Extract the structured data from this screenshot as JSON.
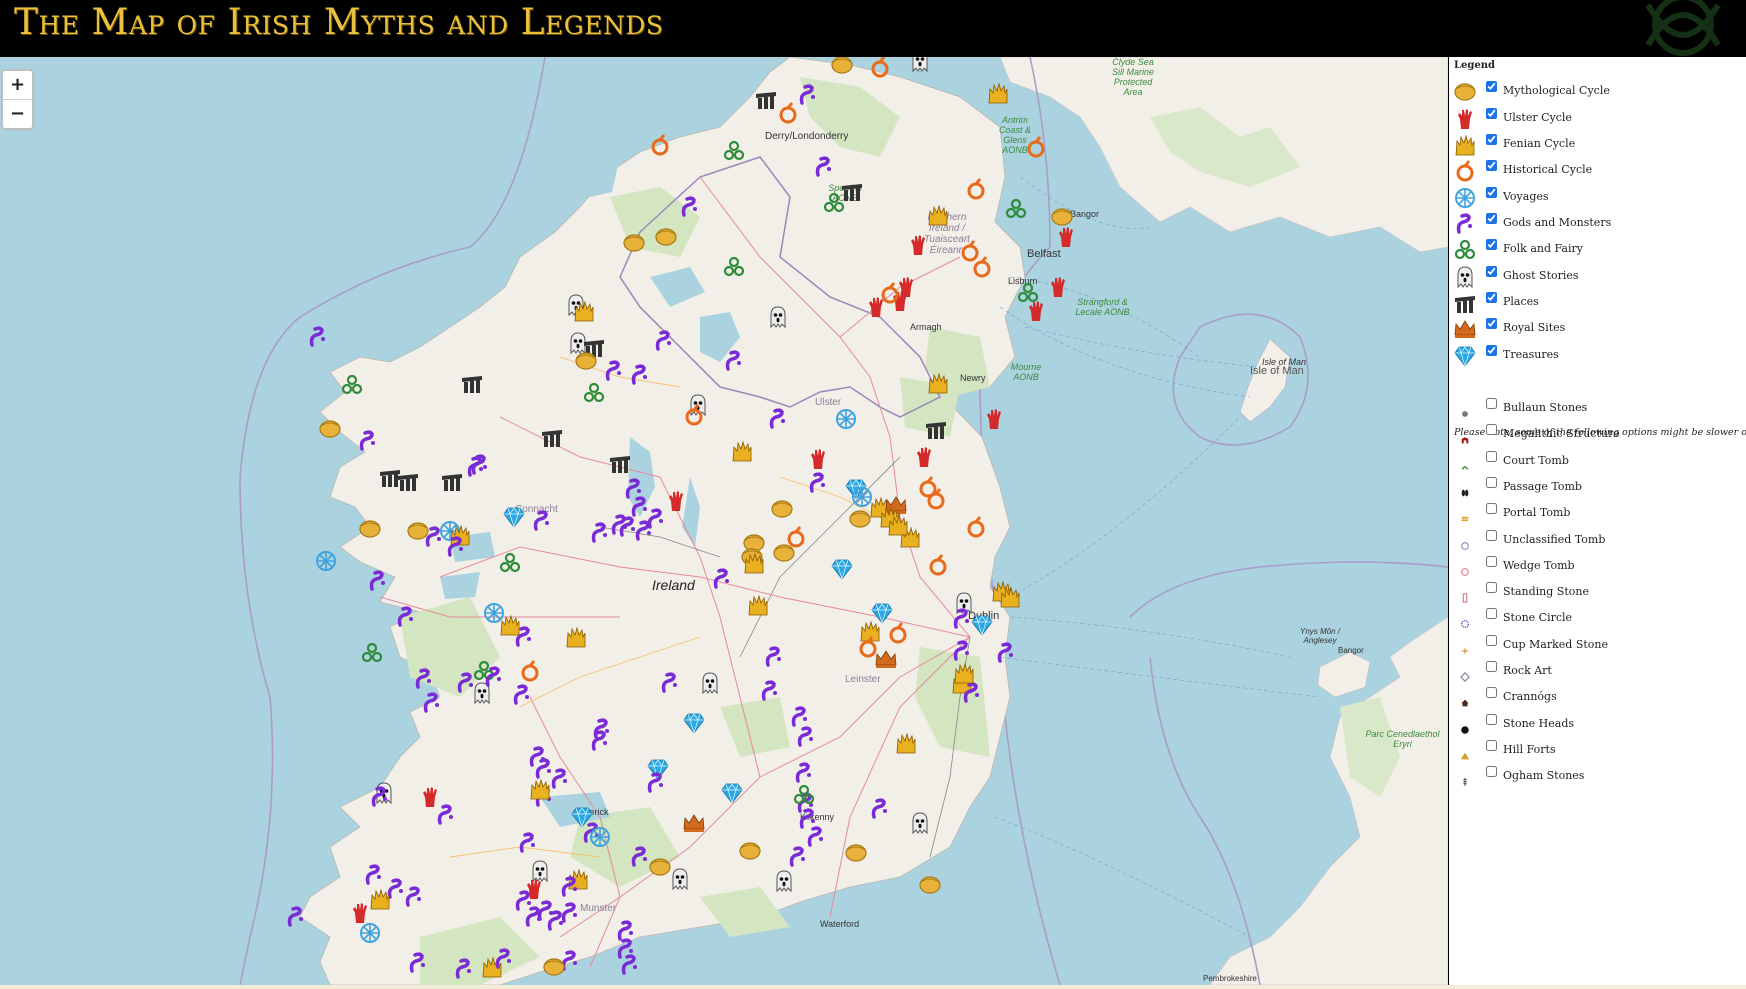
{
  "header": {
    "title": "The Map of Irish Myths and Legends"
  },
  "map": {
    "zoom_in_label": "+",
    "zoom_out_label": "−",
    "labels": {
      "derry": "Derry/Londonderry",
      "belfast": "Belfast",
      "lisburn": "Lisburn",
      "bangor_ni": "Bangor",
      "newry": "Newry",
      "armagh": "Armagh",
      "ireland": "Ireland",
      "ulster": "Ulster",
      "connacht": "Connacht",
      "leinster": "Leinster",
      "munster": "Munster",
      "dublin": "Dublin",
      "kilkenny": "Kilkenny",
      "limerick": "Limerick",
      "waterford": "Waterford",
      "ni": "Northern Ireland / Tuaisceart Éireann",
      "sperrins": "Sperrins AONB",
      "antrim": "Antrim Coast & Glens AONB",
      "mourne": "Mourne AONB",
      "strangford": "Strangford & Lecale AONB",
      "clyde": "Clyde Sea Sill Marine Protected Area",
      "iom1": "Isle of Man",
      "iom2": "Isle of Man",
      "ynys": "Ynys Môn / Anglesey",
      "bangor_wales": "Bangor",
      "eryri": "Parc Cenedlaethol Eryri",
      "pembroke": "Pembrokeshire"
    }
  },
  "legend": {
    "title": "Legend",
    "note": "Please note, some of the following options might be slower on phones:",
    "layers": [
      {
        "label": "Mythological Cycle",
        "checked": true,
        "icon": "sun-disc",
        "color": "#e8b23a"
      },
      {
        "label": "Ulster Cycle",
        "checked": true,
        "icon": "red-hand",
        "color": "#d42a2a"
      },
      {
        "label": "Fenian Cycle",
        "checked": true,
        "icon": "salmon-fire",
        "color": "#e9b020"
      },
      {
        "label": "Historical Cycle",
        "checked": true,
        "icon": "knot-ring",
        "color": "#e86a1a"
      },
      {
        "label": "Voyages",
        "checked": true,
        "icon": "compass-wheel",
        "color": "#3fa3e0"
      },
      {
        "label": "Gods and Monsters",
        "checked": true,
        "icon": "serpent",
        "color": "#7b2bd6"
      },
      {
        "label": "Folk and Fairy",
        "checked": true,
        "icon": "triskele",
        "color": "#2e8b3a"
      },
      {
        "label": "Ghost Stories",
        "checked": true,
        "icon": "ghost",
        "color": "#555555"
      },
      {
        "label": "Places",
        "checked": true,
        "icon": "dolmen",
        "color": "#333333"
      },
      {
        "label": "Royal Sites",
        "checked": true,
        "icon": "crown",
        "color": "#d2691e"
      },
      {
        "label": "Treasures",
        "checked": true,
        "icon": "diamond",
        "color": "#2aa9e6"
      }
    ],
    "monuments": [
      {
        "label": "Bullaun Stones",
        "checked": false,
        "icon": "grey-dot",
        "color": "#777777"
      },
      {
        "label": "Megalithic Structure",
        "checked": false,
        "icon": "red-arch",
        "color": "#a01818"
      },
      {
        "label": "Court Tomb",
        "checked": false,
        "icon": "green-arch",
        "color": "#2e8b3a"
      },
      {
        "label": "Passage Tomb",
        "checked": false,
        "icon": "black-split",
        "color": "#222222"
      },
      {
        "label": "Portal Tomb",
        "checked": false,
        "icon": "orange-bar",
        "color": "#e09b20"
      },
      {
        "label": "Unclassified Tomb",
        "checked": false,
        "icon": "lilac-circle",
        "color": "#9a8fc6"
      },
      {
        "label": "Wedge Tomb",
        "checked": false,
        "icon": "pink-circle",
        "color": "#e88a9a"
      },
      {
        "label": "Standing Stone",
        "checked": false,
        "icon": "pink-stone",
        "color": "#d88a8a"
      },
      {
        "label": "Stone Circle",
        "checked": false,
        "icon": "blue-ring",
        "color": "#4a4ac0"
      },
      {
        "label": "Cup Marked Stone",
        "checked": false,
        "icon": "orange-star",
        "color": "#e89a50"
      },
      {
        "label": "Rock Art",
        "checked": false,
        "icon": "grey-diamond",
        "color": "#8a8aa0"
      },
      {
        "label": "Crannógs",
        "checked": false,
        "icon": "hut",
        "color": "#4a2a1a"
      },
      {
        "label": "Stone Heads",
        "checked": false,
        "icon": "black-head",
        "color": "#111111"
      },
      {
        "label": "Hill Forts",
        "checked": false,
        "icon": "hill-triangle",
        "color": "#d4a020"
      },
      {
        "label": "Ogham Stones",
        "checked": false,
        "icon": "ogham-line",
        "color": "#555555"
      }
    ]
  }
}
